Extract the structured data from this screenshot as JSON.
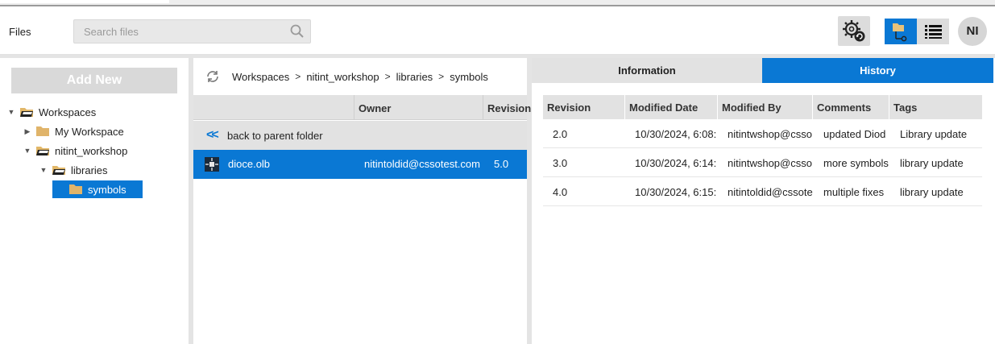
{
  "header": {
    "title": "Files",
    "search_placeholder": "Search files",
    "avatar_initials": "NI"
  },
  "left": {
    "add_new_label": "Add New",
    "tree": [
      {
        "label": "Workspaces",
        "expanded": true
      },
      {
        "label": "My Workspace",
        "expanded": false
      },
      {
        "label": "nitint_workshop",
        "expanded": true
      },
      {
        "label": "libraries",
        "expanded": true
      },
      {
        "label": "symbols",
        "selected": true
      }
    ]
  },
  "middle": {
    "breadcrumb": [
      "Workspaces",
      "nitint_workshop",
      "libraries",
      "symbols"
    ],
    "columns": {
      "owner": "Owner",
      "revision": "Revision"
    },
    "back_label": "back to parent folder",
    "files": [
      {
        "name": "dioce.olb",
        "owner": "nitintoldid@cssotest.com",
        "revision": "5.0"
      }
    ]
  },
  "right": {
    "tabs": {
      "information": "Information",
      "history": "History"
    },
    "active_tab": "History",
    "columns": [
      "Revision",
      "Modified Date",
      "Modified By",
      "Comments",
      "Tags"
    ],
    "rows": [
      {
        "revision": "2.0",
        "date": "10/30/2024, 6:08:",
        "by": "nitintwshop@csso",
        "comment": "updated Diod",
        "tag": "Library update"
      },
      {
        "revision": "3.0",
        "date": "10/30/2024, 6:14:",
        "by": "nitintwshop@csso",
        "comment": "more symbols",
        "tag": "library update"
      },
      {
        "revision": "4.0",
        "date": "10/30/2024, 6:15:",
        "by": "nitintoldid@cssote",
        "comment": "multiple fixes",
        "tag": "library update"
      }
    ]
  },
  "colors": {
    "accent": "#0a78d4",
    "panel_gray": "#e2e2e2"
  }
}
